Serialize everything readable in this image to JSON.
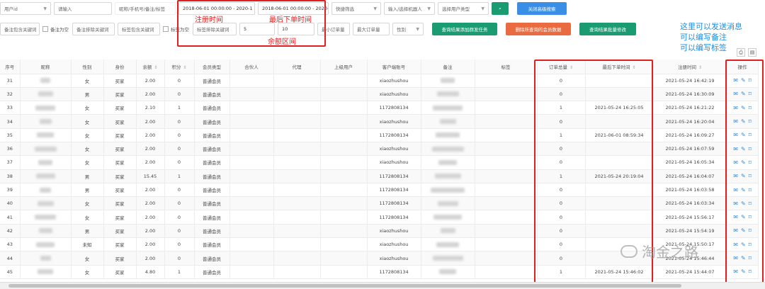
{
  "filters": {
    "field_select": "用户id",
    "keyword_placeholder": "请输入",
    "search_scope": "昵称/手机号/备注/标签",
    "reg_time_range": "2018-06-01 00:00:00 - 2020-1",
    "last_order_range": "2018-06-01 00:00:00 - 2020-1",
    "quick_filter": "快捷筛选",
    "robot_placeholder": "输入/选择机器人",
    "user_type_placeholder": "选择用户类型",
    "close_advanced": "关闭高级搜索"
  },
  "filters2": {
    "remark_include": "备注包含关键词",
    "remark_empty": "备注为空",
    "remark_exclude": "备注排除关键词",
    "tag_include": "标签包含关键词",
    "tag_empty": "标签为空",
    "tag_exclude": "标签排除关键词",
    "balance_min": "5",
    "balance_max": "10",
    "min_order": "最小订单量",
    "max_order": "最大订单量",
    "gender": "性别",
    "btn_mass_task": "查询结果添加群发任务",
    "btn_delete": "删除所查询的会员数据",
    "btn_batch_edit": "查询结果批量修改"
  },
  "annotations": {
    "reg_time": "注册时间",
    "last_order_time": "最后下单时间",
    "balance_range": "余额区间",
    "right_note_1": "这里可以发送消息",
    "right_note_2": "可以编写备注",
    "right_note_3": "可以编写标签"
  },
  "watermark": "淘金之路",
  "table": {
    "headers": [
      "序号",
      "昵称",
      "性别",
      "身份",
      "余额",
      "积分",
      "会员类型",
      "合伙人",
      "代理",
      "上级用户",
      "客户端账号",
      "备注",
      "标签",
      "订单总量",
      "最后下单时间",
      "注册时间",
      "操作"
    ],
    "rows": [
      {
        "id": "31",
        "gender": "女",
        "role": "买家",
        "balance": "2.00",
        "points": "0",
        "type": "普通会员",
        "client": "xiaozhushou",
        "orders": "0",
        "last_order": "",
        "reg": "2021-05-24 16:42:19"
      },
      {
        "id": "32",
        "gender": "男",
        "role": "买家",
        "balance": "2.00",
        "points": "0",
        "type": "普通会员",
        "client": "xiaozhushou",
        "orders": "0",
        "last_order": "",
        "reg": "2021-05-24 16:30:09"
      },
      {
        "id": "33",
        "gender": "女",
        "role": "买家",
        "balance": "2.10",
        "points": "1",
        "type": "普通会员",
        "client": "1172808134",
        "orders": "1",
        "last_order": "2021-05-24 16:25:05",
        "reg": "2021-05-24 16:21:22"
      },
      {
        "id": "34",
        "gender": "女",
        "role": "买家",
        "balance": "2.00",
        "points": "0",
        "type": "普通会员",
        "client": "xiaozhushou",
        "orders": "0",
        "last_order": "",
        "reg": "2021-05-24 16:20:04"
      },
      {
        "id": "35",
        "gender": "女",
        "role": "买家",
        "balance": "2.00",
        "points": "0",
        "type": "普通会员",
        "client": "1172808134",
        "orders": "1",
        "last_order": "2021-06-01 08:59:34",
        "reg": "2021-05-24 16:09:27"
      },
      {
        "id": "36",
        "gender": "女",
        "role": "买家",
        "balance": "2.00",
        "points": "0",
        "type": "普通会员",
        "client": "xiaozhushou",
        "orders": "0",
        "last_order": "",
        "reg": "2021-05-24 16:07:59"
      },
      {
        "id": "37",
        "gender": "女",
        "role": "买家",
        "balance": "2.00",
        "points": "0",
        "type": "普通会员",
        "client": "xiaozhushou",
        "orders": "0",
        "last_order": "",
        "reg": "2021-05-24 16:05:34"
      },
      {
        "id": "38",
        "gender": "男",
        "role": "买家",
        "balance": "15.45",
        "points": "1",
        "type": "普通会员",
        "client": "1172808134",
        "orders": "1",
        "last_order": "2021-05-24 20:19:04",
        "reg": "2021-05-24 16:04:07"
      },
      {
        "id": "39",
        "gender": "男",
        "role": "买家",
        "balance": "2.00",
        "points": "0",
        "type": "普通会员",
        "client": "1172808134",
        "orders": "0",
        "last_order": "",
        "reg": "2021-05-24 16:03:58"
      },
      {
        "id": "40",
        "gender": "女",
        "role": "买家",
        "balance": "2.00",
        "points": "0",
        "type": "普通会员",
        "client": "1172808134",
        "orders": "0",
        "last_order": "",
        "reg": "2021-05-24 16:03:34"
      },
      {
        "id": "41",
        "gender": "女",
        "role": "买家",
        "balance": "2.00",
        "points": "0",
        "type": "普通会员",
        "client": "1172808134",
        "orders": "0",
        "last_order": "",
        "reg": "2021-05-24 15:56:17"
      },
      {
        "id": "42",
        "gender": "男",
        "role": "买家",
        "balance": "2.00",
        "points": "0",
        "type": "普通会员",
        "client": "xiaozhushou",
        "orders": "0",
        "last_order": "",
        "reg": "2021-05-24 15:54:19"
      },
      {
        "id": "43",
        "gender": "未知",
        "role": "买家",
        "balance": "2.00",
        "points": "0",
        "type": "普通会员",
        "client": "xiaozhushou",
        "orders": "0",
        "last_order": "",
        "reg": "2021-05-24 15:50:17"
      },
      {
        "id": "44",
        "gender": "女",
        "role": "买家",
        "balance": "2.00",
        "points": "0",
        "type": "普通会员",
        "client": "xiaozhushou",
        "orders": "0",
        "last_order": "",
        "reg": "2021-05-24 15:46:44"
      },
      {
        "id": "45",
        "gender": "女",
        "role": "买家",
        "balance": "4.80",
        "points": "1",
        "type": "普通会员",
        "client": "1172808134",
        "orders": "1",
        "last_order": "2021-05-24 15:46:02",
        "reg": "2021-05-24 15:44:07"
      }
    ]
  },
  "colors": {
    "green": "#1b9b72",
    "blue": "#3a8ee6",
    "orange": "#ea6b3f",
    "annotation_red": "#e02020",
    "annotation_blue": "#1e8fe0"
  }
}
